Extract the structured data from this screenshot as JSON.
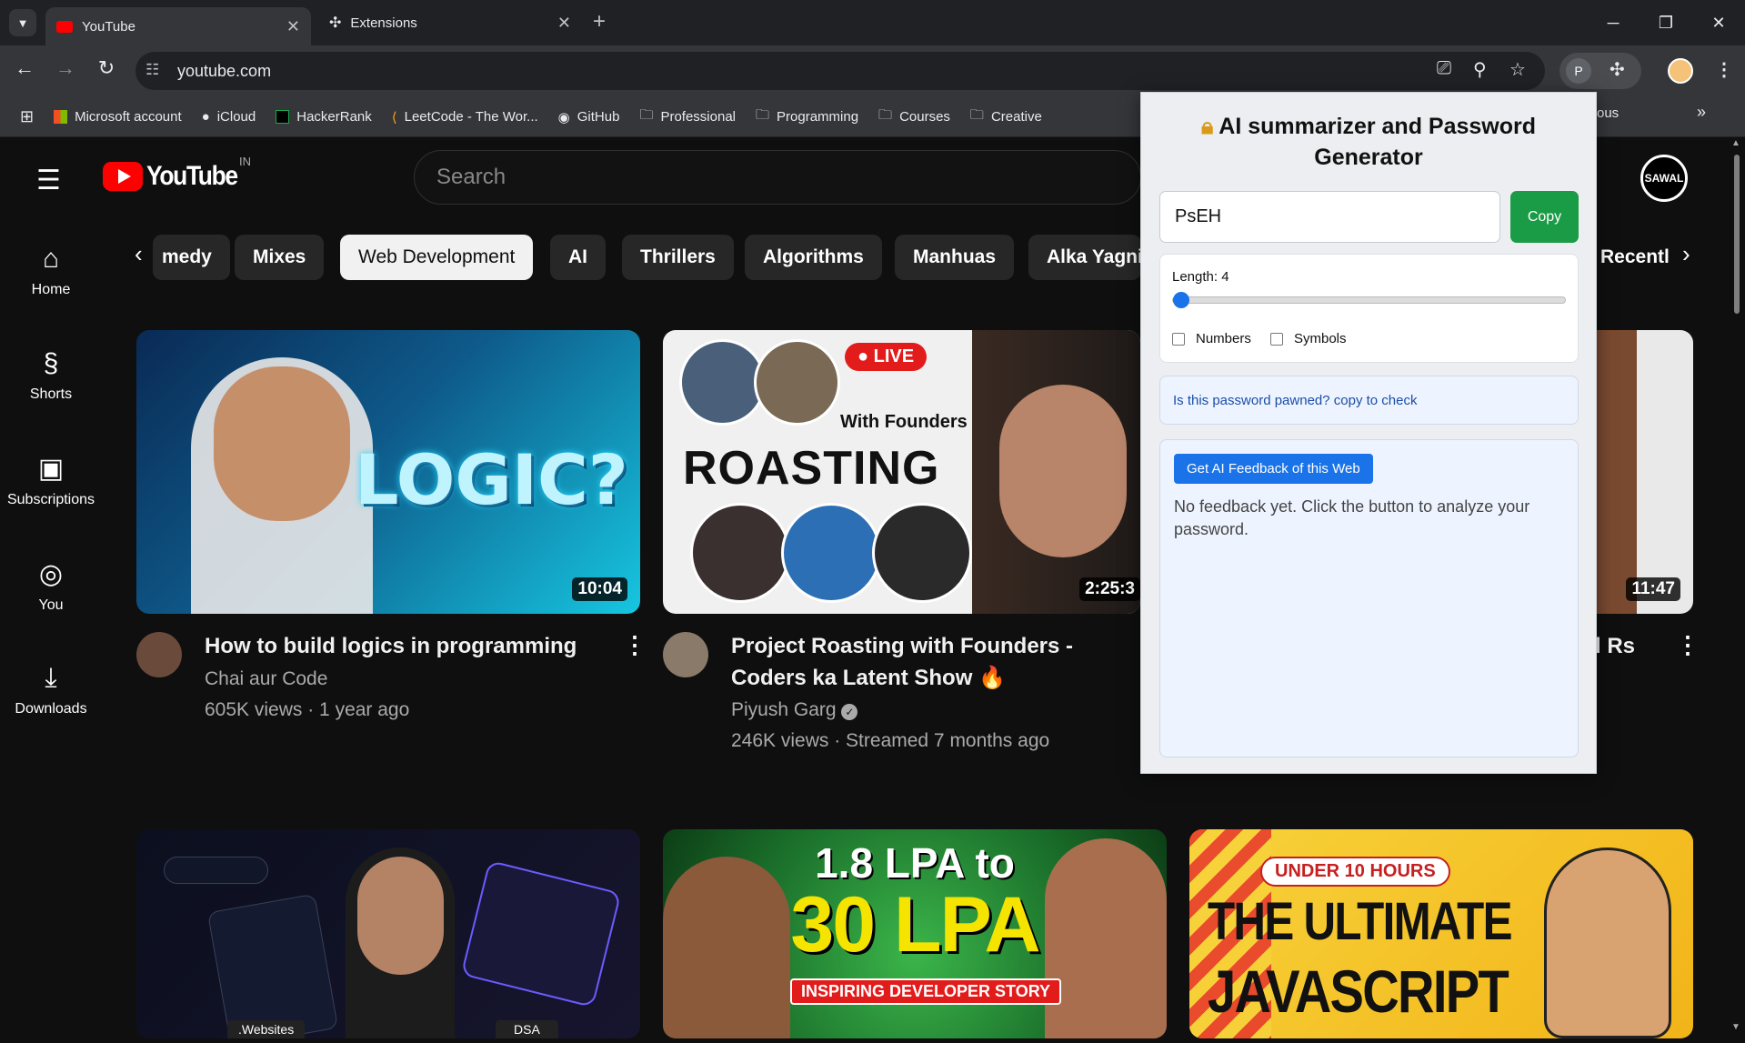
{
  "browser": {
    "tabs": [
      {
        "label": "YouTube",
        "icon": "youtube-icon"
      },
      {
        "label": "Extensions",
        "icon": "puzzle-icon"
      }
    ],
    "url": "youtube.com",
    "bookmarks": [
      {
        "label": "Microsoft account",
        "icon": "microsoft-icon"
      },
      {
        "label": "iCloud",
        "icon": "apple-icon"
      },
      {
        "label": "HackerRank",
        "icon": "hackerrank-icon"
      },
      {
        "label": "LeetCode - The Wor...",
        "icon": "leetcode-icon"
      },
      {
        "label": "GitHub",
        "icon": "github-icon"
      },
      {
        "label": "Professional",
        "icon": "folder-icon"
      },
      {
        "label": "Programming",
        "icon": "folder-icon"
      },
      {
        "label": "Courses",
        "icon": "folder-icon"
      },
      {
        "label": "Creative",
        "icon": "folder-icon"
      }
    ],
    "bookmark_tail": "ous",
    "extension_letter": "P"
  },
  "youtube": {
    "logo_text": "YouTube",
    "region": "IN",
    "search_placeholder": "Search",
    "channel_avatar": "SAWAL",
    "sidebar": [
      {
        "label": "Home",
        "icon": "home-icon"
      },
      {
        "label": "Shorts",
        "icon": "shorts-icon"
      },
      {
        "label": "Subscriptions",
        "icon": "subscriptions-icon"
      },
      {
        "label": "You",
        "icon": "user-icon"
      },
      {
        "label": "Downloads",
        "icon": "download-icon"
      }
    ],
    "chips": [
      "medy",
      "Mixes",
      "Web Development",
      "AI",
      "Thrillers",
      "Algorithms",
      "Manhuas",
      "Alka Yagni",
      "Recentl"
    ],
    "videos": [
      {
        "title": "How to build logics in programming",
        "channel": "Chai aur Code",
        "meta": "605K views · 1 year ago",
        "duration": "10:04",
        "thumb_text": "LOGIC?"
      },
      {
        "title_line1": "Project Roasting with Founders -",
        "title_line2": "Coders ka Latent Show 🔥",
        "channel": "Piyush Garg",
        "meta": "246K views · Streamed 7 months ago",
        "duration": "2:25:3",
        "thumb_text": "ROASTING",
        "live": "LIVE",
        "thumb_sub": "With Founders"
      },
      {
        "title_tail": "l Rs",
        "duration": "11:47"
      }
    ],
    "row2": [
      {
        "tags": [
          ".Websites",
          "DSA"
        ]
      },
      {
        "line1": "1.8 LPA to",
        "line2": "30 LPA",
        "line3": "INSPIRING DEVELOPER STORY"
      },
      {
        "line1": "UNDER 10 HOURS",
        "line2": "THE ULTIMATE",
        "line3": "JAVASCRIPT"
      }
    ]
  },
  "popup": {
    "title": "AI summarizer and Password Generator",
    "title_icon": "lock-icon",
    "password": "PsEH",
    "copy_label": "Copy",
    "length_label": "Length: 4",
    "length_value": 4,
    "length_fraction": 0.0,
    "numbers_label": "Numbers",
    "symbols_label": "Symbols",
    "numbers_checked": false,
    "symbols_checked": false,
    "pawned_text": "Is this password pawned? copy to check",
    "feedback_button": "Get AI Feedback of this Web",
    "feedback_text": "No feedback yet. Click the button to analyze your password."
  },
  "colors": {
    "yt_red": "#ff0000",
    "copy_green": "#1a9b45",
    "primary_blue": "#1a73e8"
  }
}
